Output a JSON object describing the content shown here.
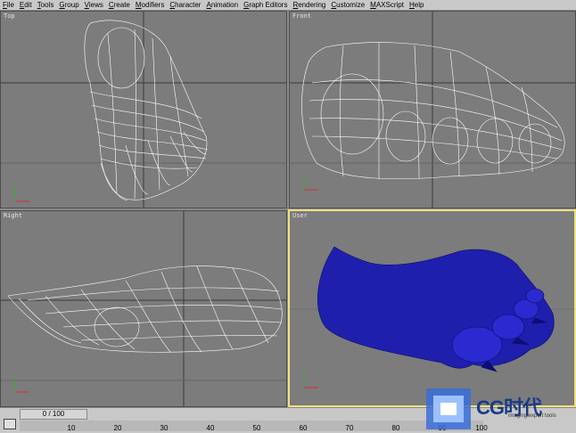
{
  "menu": [
    "File",
    "Edit",
    "Tools",
    "Group",
    "Views",
    "Create",
    "Modifiers",
    "Character",
    "Animation",
    "Graph Editors",
    "Rendering",
    "Customize",
    "MAXScript",
    "Help"
  ],
  "viewports": {
    "top": "Top",
    "front": "Front",
    "right": "Right",
    "user": "User"
  },
  "timeline": {
    "frame": "0 / 100",
    "ticks": [
      "10",
      "20",
      "30",
      "40",
      "50",
      "60",
      "70",
      "80",
      "90",
      "100"
    ]
  },
  "logo": {
    "name": "CG时代",
    "sub": "imaging export tools"
  },
  "colors": {
    "viewport_bg": "#7c7c7c",
    "wire": "#ffffff",
    "mesh_blue": "#1f1fae",
    "active_border": "#f0e080"
  }
}
